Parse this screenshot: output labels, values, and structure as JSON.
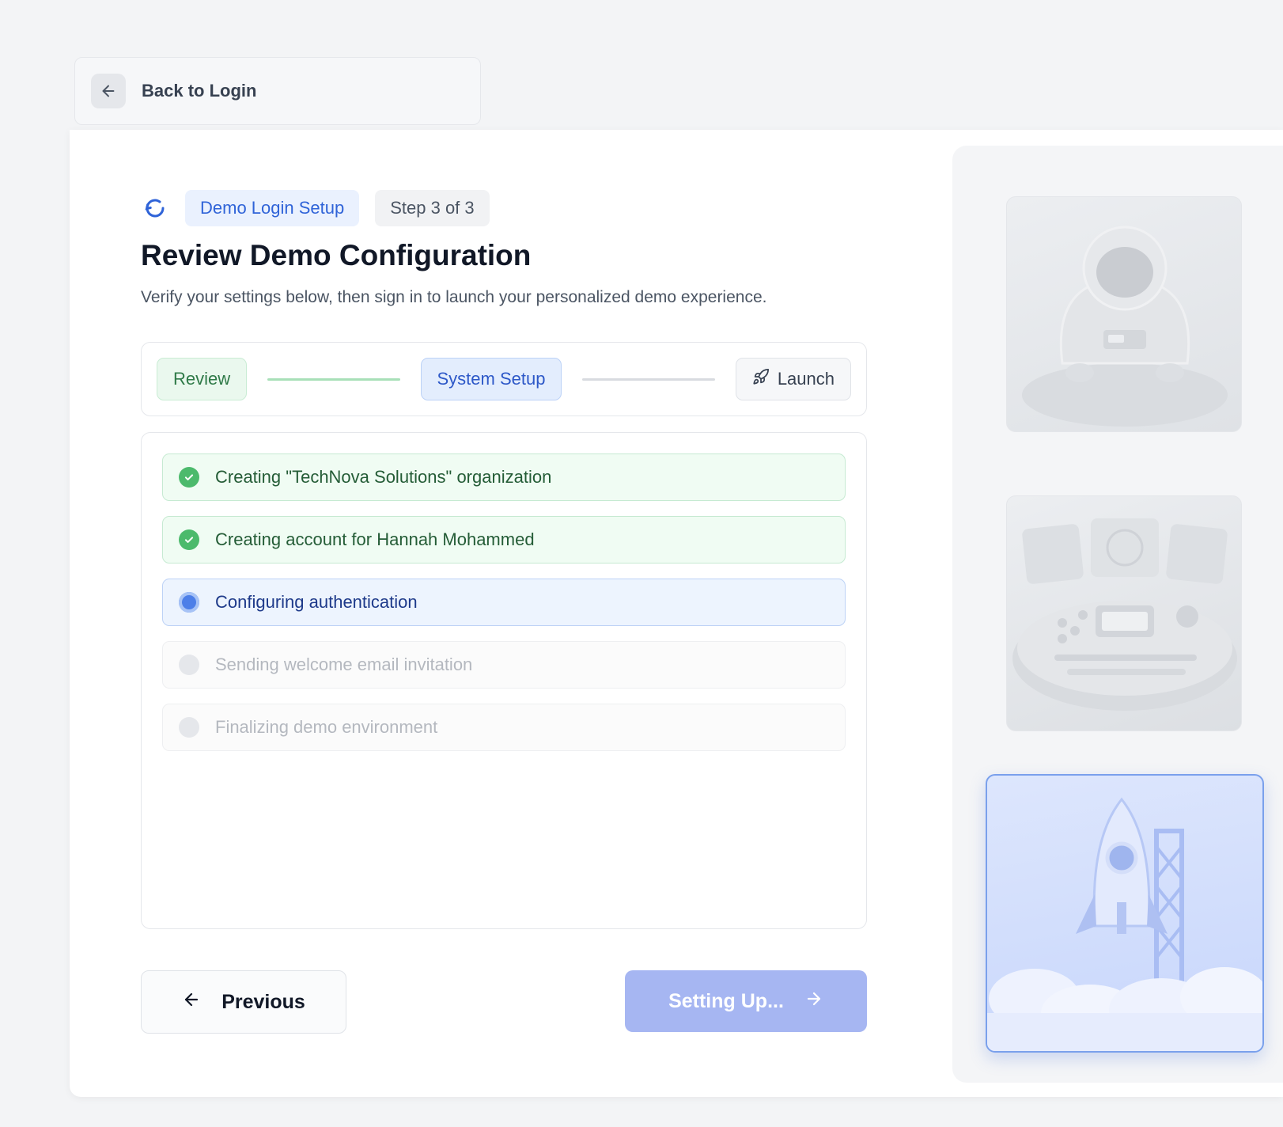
{
  "top_bar": {
    "back_label": "Back to Login"
  },
  "header": {
    "badge_setup": "Demo Login Setup",
    "badge_step": "Step 3 of 3",
    "title": "Review Demo Configuration",
    "subtitle": "Verify your settings below, then sign in to launch your personalized demo experience."
  },
  "stepper": {
    "steps": [
      {
        "label": "Review",
        "state": "done"
      },
      {
        "label": "System Setup",
        "state": "active"
      },
      {
        "label": "Launch",
        "state": "pending",
        "icon": "rocket-icon"
      }
    ]
  },
  "tasks": [
    {
      "label": "Creating \"TechNova Solutions\" organization",
      "state": "done"
    },
    {
      "label": "Creating account for Hannah Mohammed",
      "state": "done"
    },
    {
      "label": "Configuring authentication",
      "state": "active"
    },
    {
      "label": "Sending welcome email invitation",
      "state": "pending"
    },
    {
      "label": "Finalizing demo environment",
      "state": "pending"
    }
  ],
  "buttons": {
    "previous": "Previous",
    "next": "Setting Up..."
  },
  "colors": {
    "accent": "#2f63d8",
    "success": "#4cba6c",
    "button_disabled": "#a6b6f2"
  }
}
